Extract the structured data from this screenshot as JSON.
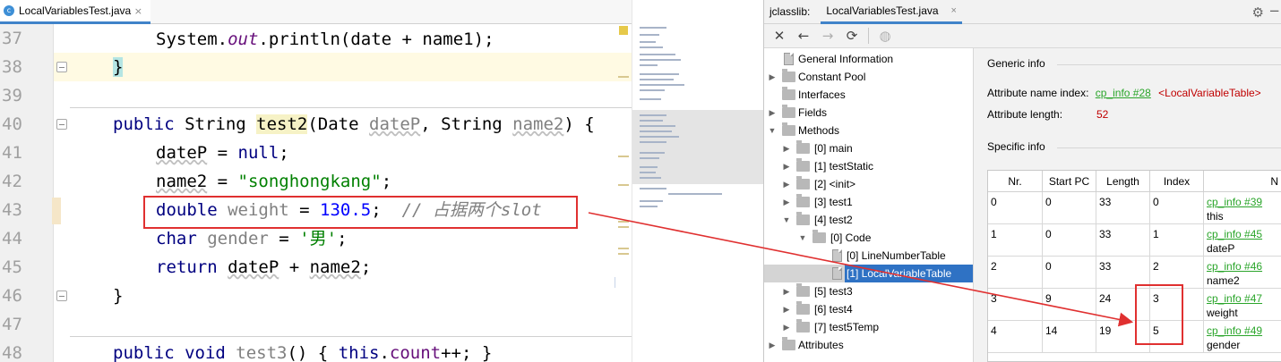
{
  "editor": {
    "tab_label": "LocalVariablesTest.java",
    "tab_close": "×",
    "file_icon": "c",
    "lines": [
      {
        "num": "37"
      },
      {
        "num": "38"
      },
      {
        "num": "39"
      },
      {
        "num": "40"
      },
      {
        "num": "41"
      },
      {
        "num": "42"
      },
      {
        "num": "43"
      },
      {
        "num": "44"
      },
      {
        "num": "45"
      },
      {
        "num": "46"
      },
      {
        "num": "47"
      },
      {
        "num": "48"
      }
    ],
    "code": {
      "l37_a": "System.",
      "l37_b": "out",
      "l37_c": ".println(date + name1);",
      "l38_brace": "}",
      "l40_a": "public ",
      "l40_b": "String ",
      "l40_m": "test2",
      "l40_c": "(Date ",
      "l40_p1": "dateP",
      "l40_d": ", String ",
      "l40_p2": "name2",
      "l40_e": ") {",
      "l41_a": "dateP",
      "l41_b": " = ",
      "l41_c": "null",
      "l41_d": ";",
      "l42_a": "name2",
      "l42_b": " = ",
      "l42_c": "\"songhongkang\"",
      "l42_d": ";",
      "l43_a": "double ",
      "l43_b": "weight",
      "l43_c": " = ",
      "l43_d": "130.5",
      "l43_e": ";  ",
      "l43_f": "// 占据两个slot",
      "l44_a": "char ",
      "l44_b": "gender",
      "l44_c": " = ",
      "l44_d": "'男'",
      "l44_e": ";",
      "l45_a": "return ",
      "l45_b": "dateP",
      "l45_c": " + ",
      "l45_d": "name2",
      "l45_e": ";",
      "l46_brace": "}",
      "l48_a": "public ",
      "l48_b": "void ",
      "l48_m": "test3",
      "l48_c": "() { ",
      "l48_d": "this",
      "l48_e": ".",
      "l48_f": "count",
      "l48_g": "++; }"
    }
  },
  "jclasslib": {
    "title": "jclasslib:",
    "tab_label": "LocalVariablesTest.java",
    "tab_close": "×",
    "gear": "⚙",
    "minus": "−",
    "toolbar": {
      "close": "✕",
      "back": "←",
      "forward": "→",
      "refresh": "⟳",
      "web": "◍"
    },
    "tree": [
      {
        "label": "General Information"
      },
      {
        "label": "Constant Pool"
      },
      {
        "label": "Interfaces"
      },
      {
        "label": "Fields"
      },
      {
        "label": "Methods"
      },
      {
        "label": "[0] main"
      },
      {
        "label": "[1] testStatic"
      },
      {
        "label": "[2] <init>"
      },
      {
        "label": "[3] test1"
      },
      {
        "label": "[4] test2"
      },
      {
        "label": "[0] Code"
      },
      {
        "label": "[0] LineNumberTable"
      },
      {
        "label": "[1] LocalVariableTable"
      },
      {
        "label": "[5] test3"
      },
      {
        "label": "[6] test4"
      },
      {
        "label": "[7] test5Temp"
      },
      {
        "label": "Attributes"
      }
    ],
    "generic_info": {
      "title": "Generic info",
      "name_index_label": "Attribute name index:",
      "name_index_link": "cp_info #28",
      "name_index_value": "<LocalVariableTable>",
      "length_label": "Attribute length:",
      "length_value": "52"
    },
    "specific_info": {
      "title": "Specific info",
      "columns": [
        "Nr.",
        "Start PC",
        "Length",
        "Index",
        "N"
      ],
      "rows": [
        {
          "nr": "0",
          "start": "0",
          "length": "33",
          "index": "0",
          "link": "cp_info #39",
          "name": "this"
        },
        {
          "nr": "1",
          "start": "0",
          "length": "33",
          "index": "1",
          "link": "cp_info #45",
          "name": "dateP"
        },
        {
          "nr": "2",
          "start": "0",
          "length": "33",
          "index": "2",
          "link": "cp_info #46",
          "name": "name2"
        },
        {
          "nr": "3",
          "start": "9",
          "length": "24",
          "index": "3",
          "link": "cp_info #47",
          "name": "weight"
        },
        {
          "nr": "4",
          "start": "14",
          "length": "19",
          "index": "5",
          "link": "cp_info #49",
          "name": "gender"
        }
      ]
    }
  },
  "colors": {
    "accent": "#4083c9",
    "selection": "#2f72c4",
    "annotation_red": "#e03030",
    "link_green": "#2aa52a"
  }
}
